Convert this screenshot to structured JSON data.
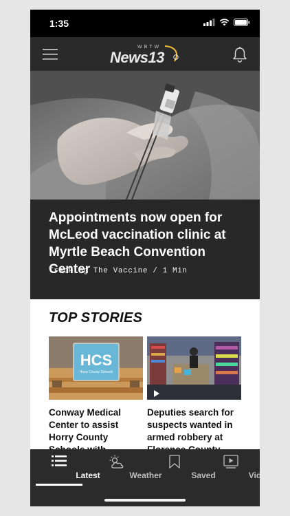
{
  "status_bar": {
    "time": "1:35",
    "icons": [
      "cellular-signal-icon",
      "wifi-icon",
      "battery-icon"
    ]
  },
  "header": {
    "menu_icon": "hamburger-menu-icon",
    "logo": {
      "top": "WBTW",
      "main": "News13"
    },
    "notifications_icon": "bell-icon"
  },
  "hero": {
    "image": "vaccine-syringe-photo",
    "headline": "Appointments now open for McLeod vaccination clinic at Myrtle Beach Convention Center",
    "meta": "Tracking The Vaccine / 1 Min"
  },
  "top_stories": {
    "title": "TOP STORIES",
    "stories": [
      {
        "image": "hcs-classroom-photo",
        "image_text": {
          "logo": "HCS",
          "subtitle": "Horry County Schools"
        },
        "title": "Conway Medical Center to assist Horry County Schools with vaccinating teachers"
      },
      {
        "image": "store-surveillance-video",
        "title": "Deputies search for suspects wanted in armed robbery at Florence County Doll..."
      }
    ]
  },
  "tab_bar": {
    "tabs": [
      {
        "label": "Latest",
        "icon": "latest-list-icon",
        "active": true
      },
      {
        "label": "Weather",
        "icon": "weather-icon",
        "active": false
      },
      {
        "label": "Saved",
        "icon": "bookmark-icon",
        "active": false
      },
      {
        "label": "Video",
        "icon": "video-play-icon",
        "active": false
      }
    ]
  },
  "colors": {
    "header_bg": "#2a2a2a",
    "hero_text_bg": "#282828",
    "tab_bar_bg": "#2b2b2b",
    "content_bg": "#ffffff",
    "accent_logo": "#f2c13a"
  }
}
